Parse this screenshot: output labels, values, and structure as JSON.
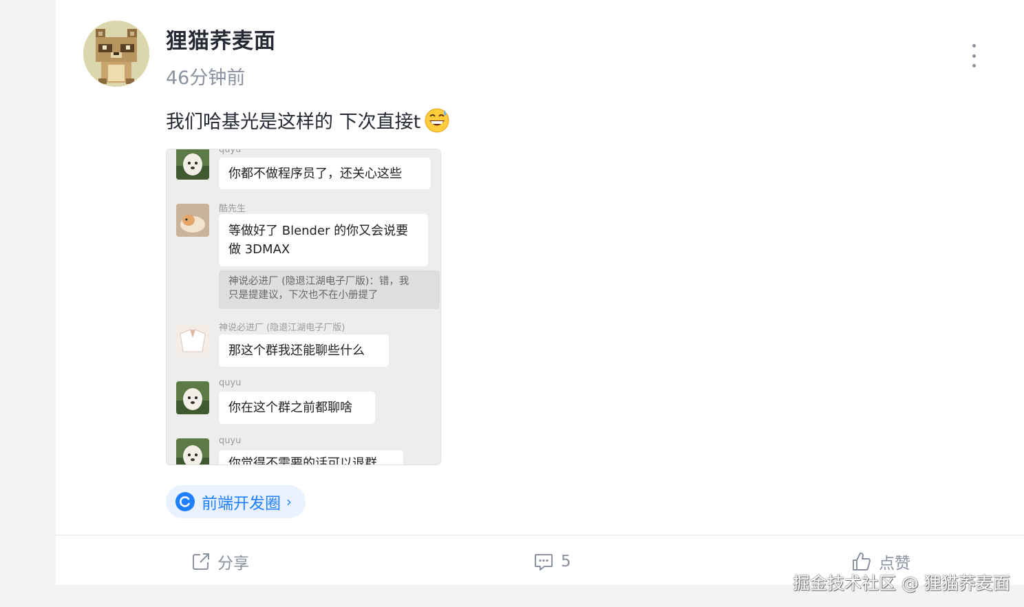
{
  "post": {
    "author": "狸猫荞麦面",
    "time": "46分钟前",
    "content": "我们哈基光是这样的 下次直接t",
    "emoji_icon": "grinning-sweat-emoji"
  },
  "screenshot": {
    "top_partial_name": "quyu",
    "messages": [
      {
        "name": "",
        "text": "你都不做程序员了，还关心这些"
      },
      {
        "name": "酷先生",
        "text_line1": "等做好了 Blender 的你又会说要",
        "text_line2": "做 3DMAX"
      },
      {
        "quote_line1": "神说必进厂 (隐退江湖电子厂版)：错，我",
        "quote_line2": "只是提建议，下次也不在小册提了"
      },
      {
        "name": "神说必进厂 (隐退江湖电子厂版)",
        "text": "那这个群我还能聊些什么"
      },
      {
        "name": "quyu",
        "text": "你在这个群之前都聊啥"
      },
      {
        "name": "quyu",
        "text": "你觉得不需要的话可以退群"
      }
    ]
  },
  "topic": {
    "label": "前端开发圈",
    "arrow": "›"
  },
  "actions": {
    "share": "分享",
    "comments": "5",
    "like": "点赞"
  },
  "watermark": "掘金技术社区 @ 狸猫荞麦面",
  "colors": {
    "accent": "#1e80ff",
    "muted": "#8a919f",
    "text": "#252933"
  }
}
